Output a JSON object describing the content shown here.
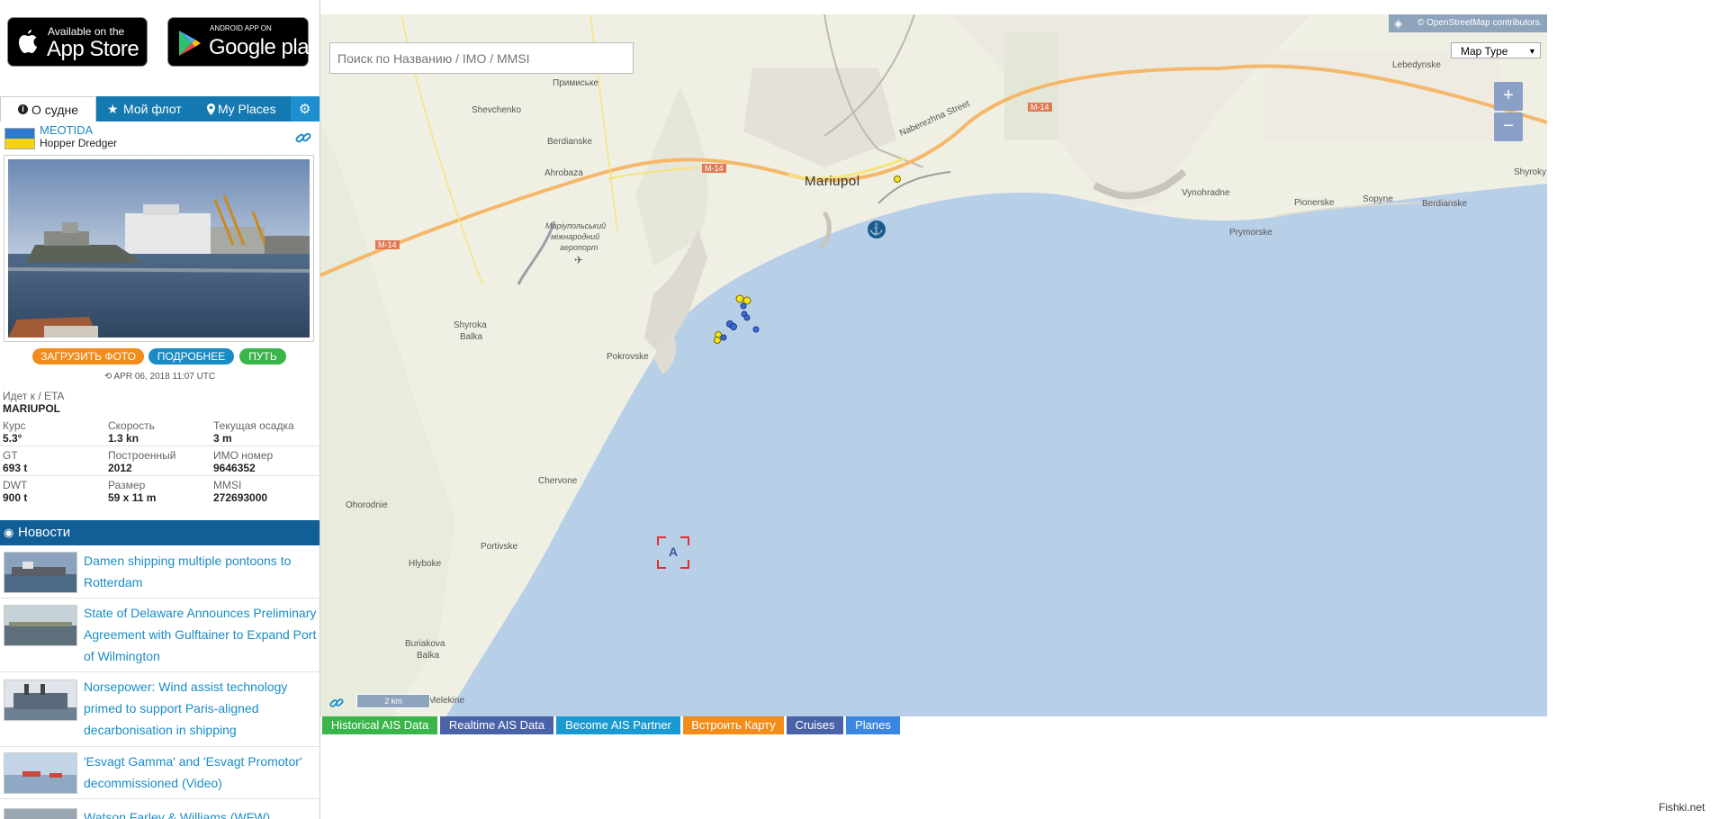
{
  "store_badges": {
    "appstore": {
      "small": "Available on the",
      "big": "App Store"
    },
    "gplay": {
      "small": "ANDROID APP ON",
      "big": "Google play"
    }
  },
  "tabs": {
    "about": "О судне",
    "fleet": "Мой флот",
    "places": "My Places"
  },
  "vessel": {
    "name": "MEOTIDA",
    "type": "Hopper Dredger",
    "buttons": {
      "upload": "ЗАГРУЗИТЬ ФОТО",
      "details": "ПОДРОБНЕЕ",
      "route": "ПУТЬ"
    },
    "timestamp": "APR 06, 2018 11:07 UTC",
    "destination_label": "Идет к / ETA",
    "destination": "MARIUPOL",
    "fields": [
      [
        {
          "label": "Курс",
          "value": "5.3°"
        },
        {
          "label": "Скорость",
          "value": "1.3 kn"
        },
        {
          "label": "Текущая осадка",
          "value": "3 m"
        }
      ],
      [
        {
          "label": "GT",
          "value": "693 t"
        },
        {
          "label": "Построенный",
          "value": "2012"
        },
        {
          "label": "ИМО номер",
          "value": "9646352"
        }
      ],
      [
        {
          "label": "DWT",
          "value": "900 t"
        },
        {
          "label": "Размер",
          "value": "59 x 11 m"
        },
        {
          "label": "MMSI",
          "value": "272693000"
        }
      ]
    ],
    "colors": {
      "upload": "#f28c1a",
      "details": "#1a8cc5",
      "route": "#3ab54a"
    }
  },
  "news": {
    "title": "Новости",
    "items": [
      {
        "text": "Damen shipping multiple pontoons to Rotterdam"
      },
      {
        "text": "State of Delaware Announces Preliminary Agreement with Gulftainer to Expand Port of Wilmington"
      },
      {
        "text": "Norsepower: Wind assist technology primed to support Paris-aligned decarbonisation in shipping"
      },
      {
        "text": "'Esvagt Gamma' and 'Esvagt Promotor' decommissioned (Video)"
      },
      {
        "text": "Watson Farley & Williams (WFW)"
      }
    ]
  },
  "map": {
    "search_placeholder": "Поиск по Названию / IMO / MMSI",
    "attribution": "© OpenStreetMap contributors.",
    "map_type": "Map Type",
    "zoom_in": "+",
    "zoom_out": "−",
    "scale": "2 km",
    "labels": {
      "mariupol": "Mariupol",
      "naberezhna": "Naberezhna Street",
      "m14_1": "M-14",
      "m14_2": "M-14",
      "m14_3": "M-14",
      "primiske": "Примиське",
      "shevchenko": "Shevchenko",
      "berdianske1": "Berdianske",
      "ahrobaza": "Ahrobaza",
      "airport_1": "Маріупольський",
      "airport_2": "міжнародний",
      "airport_3": "аеропорт",
      "shyroka_1": "Shyroka",
      "shyroka_2": "Balka",
      "pokrovske": "Pokrovske",
      "lebedynske": "Lebedynske",
      "vynohradne": "Vynohradne",
      "pionerske": "Pionerske",
      "sopyne": "Sopyne",
      "berdianske2": "Berdianske",
      "shyroky": "Shyroky",
      "prymorske": "Prymorske",
      "chervone": "Chervone",
      "ohorodnie": "Ohorodnie",
      "portivske": "Portivske",
      "hlyboke": "Hlyboke",
      "buriakova_1": "Buriakova",
      "buriakova_2": "Balka",
      "melekine": "Melekine",
      "target_letter": "A"
    }
  },
  "bottom_buttons": [
    {
      "label": "Historical AIS Data",
      "color": "#3ab54a"
    },
    {
      "label": "Realtime AIS Data",
      "color": "#4a62a8"
    },
    {
      "label": "Become AIS Partner",
      "color": "#1a9ad0"
    },
    {
      "label": "Встроить Карту",
      "color": "#f28c1a"
    },
    {
      "label": "Cruises",
      "color": "#4a62a8"
    },
    {
      "label": "Planes",
      "color": "#3a86e0"
    }
  ],
  "watermark": "Fishki.net"
}
